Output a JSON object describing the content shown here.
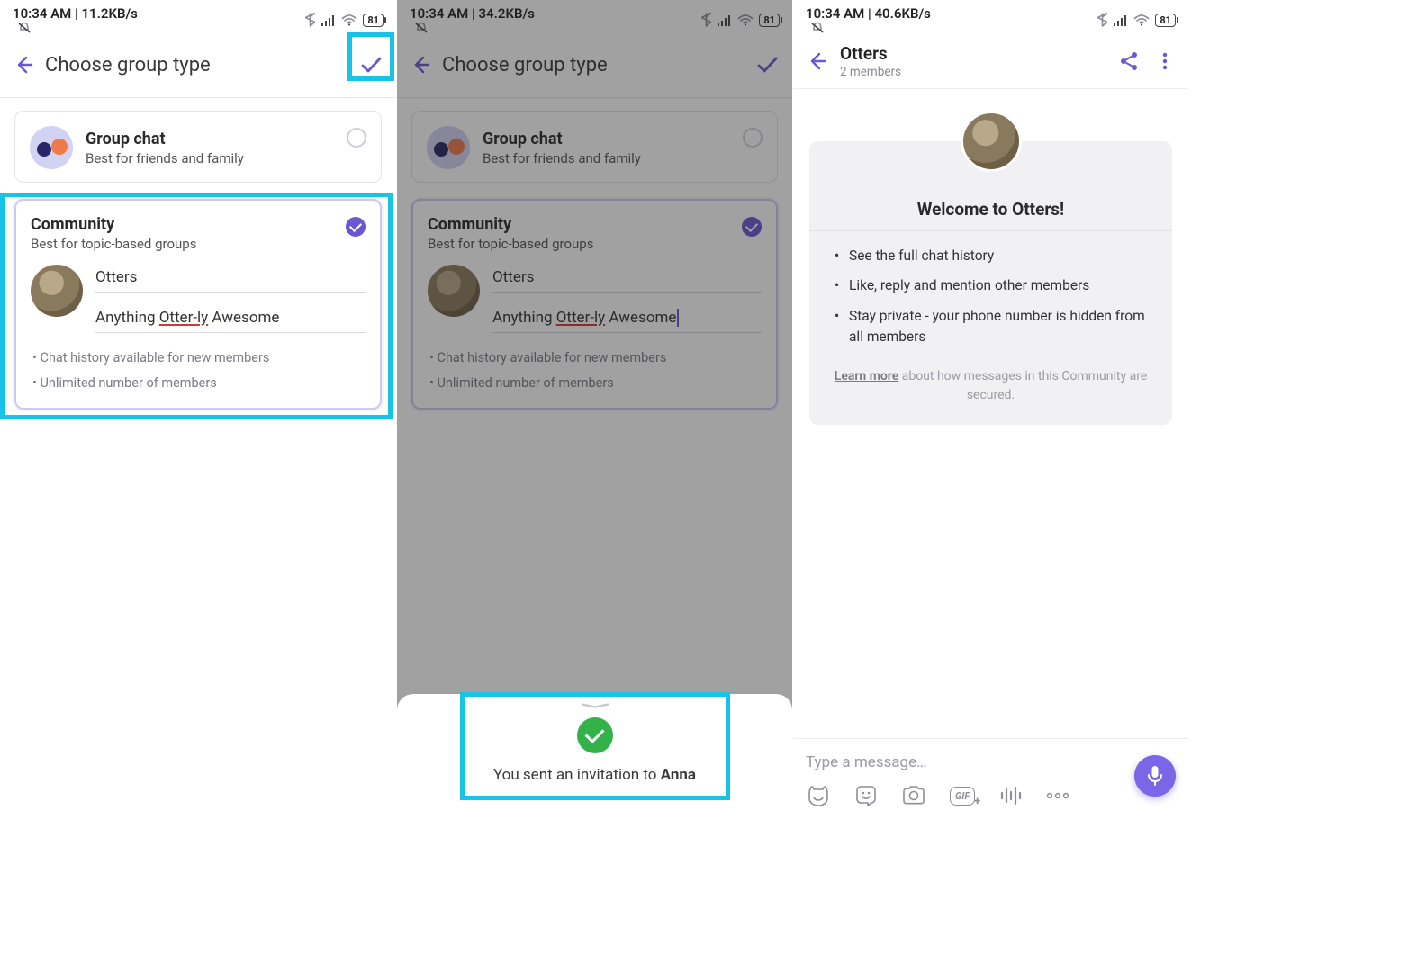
{
  "panels": [
    {
      "status": {
        "time": "10:34 AM",
        "net": "11.2KB/s",
        "battery": "81"
      },
      "header": {
        "title": "Choose group type"
      },
      "group_chat": {
        "title": "Group chat",
        "subtitle": "Best for friends and family",
        "selected": false
      },
      "community": {
        "title": "Community",
        "subtitle": "Best for topic-based groups",
        "selected": true,
        "name_value": "Otters",
        "desc_prefix": "Anything ",
        "desc_err": "Otter-ly",
        "desc_suffix": " Awesome",
        "features": [
          "Chat history available for new members",
          "Unlimited number of members"
        ]
      }
    },
    {
      "status": {
        "time": "10:34 AM",
        "net": "34.2KB/s",
        "battery": "81"
      },
      "header": {
        "title": "Choose group type"
      },
      "group_chat": {
        "title": "Group chat",
        "subtitle": "Best for friends and family",
        "selected": false
      },
      "community": {
        "title": "Community",
        "subtitle": "Best for topic-based groups",
        "selected": true,
        "name_value": "Otters",
        "desc_prefix": "Anything ",
        "desc_err": "Otter-ly",
        "desc_suffix": " Awesome",
        "features": [
          "Chat history available for new members",
          "Unlimited number of members"
        ]
      },
      "toast": {
        "prefix": "You sent an invitation to ",
        "name": "Anna"
      }
    },
    {
      "status": {
        "time": "10:34 AM",
        "net": "40.6KB/s",
        "battery": "81"
      },
      "chat": {
        "name": "Otters",
        "members": "2 members"
      },
      "welcome": {
        "title": "Welcome to Otters!",
        "items": [
          "See the full chat history",
          "Like, reply and mention other members",
          "Stay private - your phone number is hidden from all members"
        ],
        "learn_more": "Learn more",
        "foot_rest": " about how messages in this Community are secured."
      },
      "composer": {
        "placeholder": "Type a message…"
      }
    }
  ]
}
